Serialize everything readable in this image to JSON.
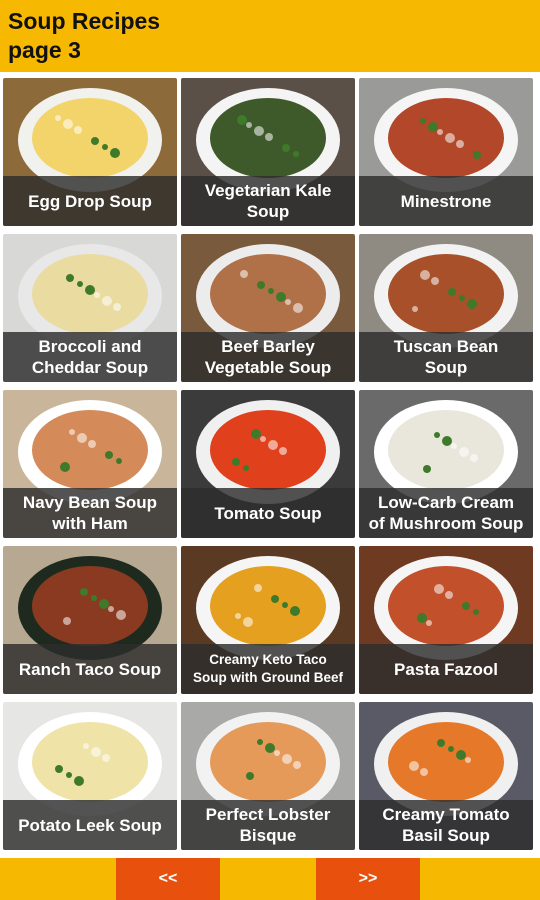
{
  "header": {
    "title_line1": "Soup Recipes",
    "title_line2": "page 3"
  },
  "recipes": [
    {
      "name": "Egg Drop Soup",
      "bg": "#8d6a3a",
      "bowl": "#f1f1ee",
      "soup": "#f3d46a"
    },
    {
      "name": "Vegetarian Kale\nSoup",
      "bg": "#5a5048",
      "bowl": "#f4f4f4",
      "soup": "#3f5a2a"
    },
    {
      "name": "Minestrone",
      "bg": "#9a9a98",
      "bowl": "#f5f5f5",
      "soup": "#b2472a"
    },
    {
      "name": "Broccoli and\nCheddar Soup",
      "bg": "#d8d8d6",
      "bowl": "#e8e8e8",
      "soup": "#eadba1"
    },
    {
      "name": "Beef Barley\nVegetable Soup",
      "bg": "#7a5a3c",
      "bowl": "#ececec",
      "soup": "#b07048"
    },
    {
      "name": "Tuscan Bean\nSoup",
      "bg": "#8f8a82",
      "bowl": "#f2f2f2",
      "soup": "#a8502a"
    },
    {
      "name": "Navy Bean Soup\nwith Ham",
      "bg": "#c9b59a",
      "bowl": "#ffffff",
      "soup": "#d58a5a"
    },
    {
      "name": "Tomato Soup",
      "bg": "#3b3b3b",
      "bowl": "#f0f0f0",
      "soup": "#e0401c"
    },
    {
      "name": "Low-Carb Cream\nof Mushroom Soup",
      "bg": "#6a6a6a",
      "bowl": "#ffffff",
      "soup": "#e9e6dc"
    },
    {
      "name": "Ranch Taco Soup",
      "bg": "#b7a892",
      "bowl": "#1f2a1f",
      "soup": "#8a3a20"
    },
    {
      "name": "Creamy Keto Taco\nSoup with Ground Beef",
      "bg": "#5a3a22",
      "bowl": "#f5f5f5",
      "soup": "#e5a020",
      "small": true
    },
    {
      "name": "Pasta Fazool",
      "bg": "#6e3a22",
      "bowl": "#f5f5f5",
      "soup": "#c2502a"
    },
    {
      "name": "Potato Leek Soup",
      "bg": "#e6e6e4",
      "bowl": "#ffffff",
      "soup": "#efe3a8"
    },
    {
      "name": "Perfect Lobster\nBisque",
      "bg": "#a9a9a7",
      "bowl": "#f2f2f2",
      "soup": "#e59a5a"
    },
    {
      "name": "Creamy Tomato\nBasil Soup",
      "bg": "#5a5a66",
      "bowl": "#f0f0f0",
      "soup": "#e6782a"
    }
  ],
  "footer": {
    "prev_label": "<<",
    "next_label": ">>"
  }
}
